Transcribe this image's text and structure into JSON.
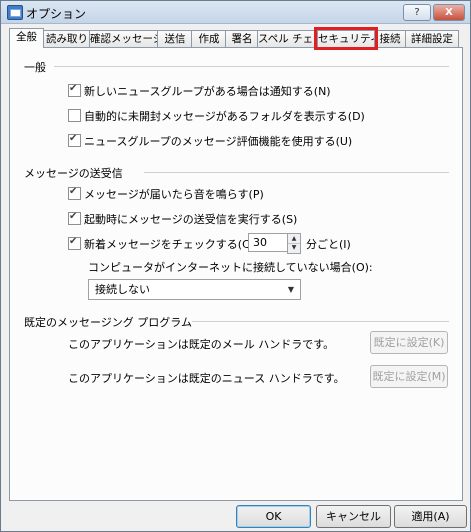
{
  "window": {
    "title": "オプション",
    "help_label": "?",
    "close_label": "X"
  },
  "tabs": [
    {
      "label": "全般"
    },
    {
      "label": "読み取り"
    },
    {
      "label": "確認メッセージ"
    },
    {
      "label": "送信"
    },
    {
      "label": "作成"
    },
    {
      "label": "署名"
    },
    {
      "label": "スペル チェック"
    },
    {
      "label": "セキュリティ"
    },
    {
      "label": "接続"
    },
    {
      "label": "詳細設定"
    }
  ],
  "general": {
    "title": "一般",
    "options": [
      {
        "label": "新しいニュースグループがある場合は通知する(N)",
        "checked": true
      },
      {
        "label": "自動的に未開封メッセージがあるフォルダを表示する(D)",
        "checked": false
      },
      {
        "label": "ニュースグループのメッセージ評価機能を使用する(U)",
        "checked": true
      }
    ]
  },
  "send_receive": {
    "title": "メッセージの送受信",
    "options": [
      {
        "label": "メッセージが届いたら音を鳴らす(P)",
        "checked": true
      },
      {
        "label": "起動時にメッセージの送受信を実行する(S)",
        "checked": true
      },
      {
        "label": "新着メッセージをチェックする(C)",
        "checked": true
      }
    ],
    "interval_value": "30",
    "interval_unit": "分ごと(I)",
    "offline_label": "コンピュータがインターネットに接続していない場合(O):",
    "offline_value": "接続しない"
  },
  "default_programs": {
    "title": "既定のメッセージング プログラム",
    "mail_text": "このアプリケーションは既定のメール ハンドラです。",
    "mail_button": "既定に設定(K)",
    "news_text": "このアプリケーションは既定のニュース ハンドラです。",
    "news_button": "既定に設定(M)"
  },
  "footer": {
    "ok": "OK",
    "cancel": "キャンセル",
    "apply": "適用(A)"
  }
}
